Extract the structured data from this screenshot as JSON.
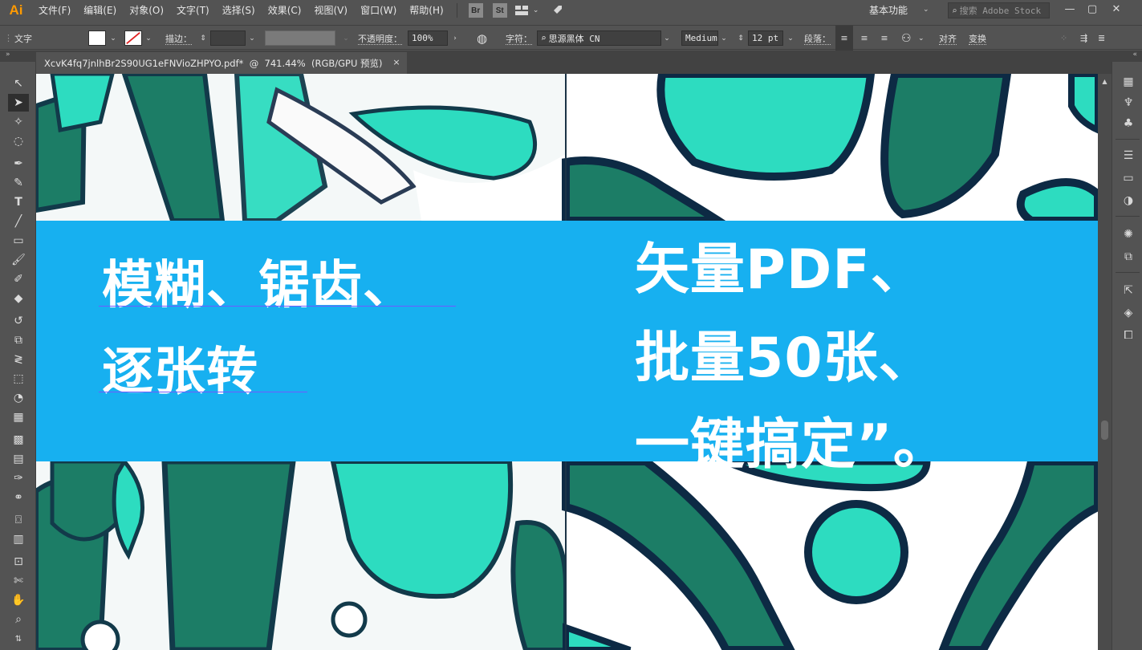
{
  "app": {
    "logo": "Ai",
    "menu": [
      "文件(F)",
      "编辑(E)",
      "对象(O)",
      "文字(T)",
      "选择(S)",
      "效果(C)",
      "视图(V)",
      "窗口(W)",
      "帮助(H)"
    ],
    "badges": [
      "Br",
      "St"
    ],
    "icons": [
      "arrange-documents-icon",
      "rocket-icon"
    ],
    "workspace": "基本功能",
    "stock_search_placeholder": "搜索 Adobe Stock",
    "window_buttons": [
      "minimize-icon",
      "maximize-icon",
      "close-icon"
    ]
  },
  "control_bar": {
    "selection_type": "文字",
    "stroke_label": "描边：",
    "opacity_label": "不透明度：",
    "opacity_value": "100%",
    "char_label": "字符：",
    "font_family": "思源黑体 CN",
    "font_style": "Medium",
    "font_size": "12 pt",
    "paragraph_label": "段落：",
    "align_label": "对齐",
    "transform_label": "变换"
  },
  "document": {
    "tab_title": "XcvK4fq7jnlhBr2S90UG1eFNVioZHPYO.pdf*  @  741.44%  (RGB/GPU 预览)",
    "close_symbol": "×"
  },
  "artwork": {
    "left_lines": [
      "模糊、锯齿、",
      "逐张转"
    ],
    "right_lines": [
      "矢量PDF、",
      "批量50张、",
      "一键搞定”。"
    ],
    "colors": {
      "banner": "#17b0f0",
      "dark_green": "#1c7d66",
      "mint": "#2ddcc0",
      "outline": "#0d2a44",
      "background": "#ffffff"
    }
  },
  "tools": [
    "selection-tool-icon",
    "direct-selection-tool-icon",
    "magic-wand-tool-icon",
    "lasso-tool-icon",
    "pen-tool-icon",
    "curvature-tool-icon",
    "type-tool-icon",
    "line-tool-icon",
    "rectangle-tool-icon",
    "paintbrush-tool-icon",
    "shaper-tool-icon",
    "eraser-tool-icon",
    "rotate-tool-icon",
    "scale-tool-icon",
    "width-tool-icon",
    "free-transform-tool-icon",
    "shape-builder-tool-icon",
    "perspective-grid-tool-icon",
    "mesh-tool-icon",
    "gradient-tool-icon",
    "eyedropper-tool-icon",
    "blend-tool-icon",
    "symbol-sprayer-tool-icon",
    "graph-tool-icon",
    "artboard-tool-icon",
    "slice-tool-icon",
    "hand-tool-icon",
    "zoom-tool-icon"
  ],
  "right_panel": [
    "color-panel-icon",
    "brushes-panel-icon",
    "symbols-panel-icon",
    "stroke-panel-icon",
    "gradient-panel-icon",
    "transparency-panel-icon",
    "appearance-panel-icon",
    "graphic-styles-panel-icon",
    "asset-export-panel-icon",
    "layers-panel-icon",
    "artboards-panel-icon"
  ]
}
